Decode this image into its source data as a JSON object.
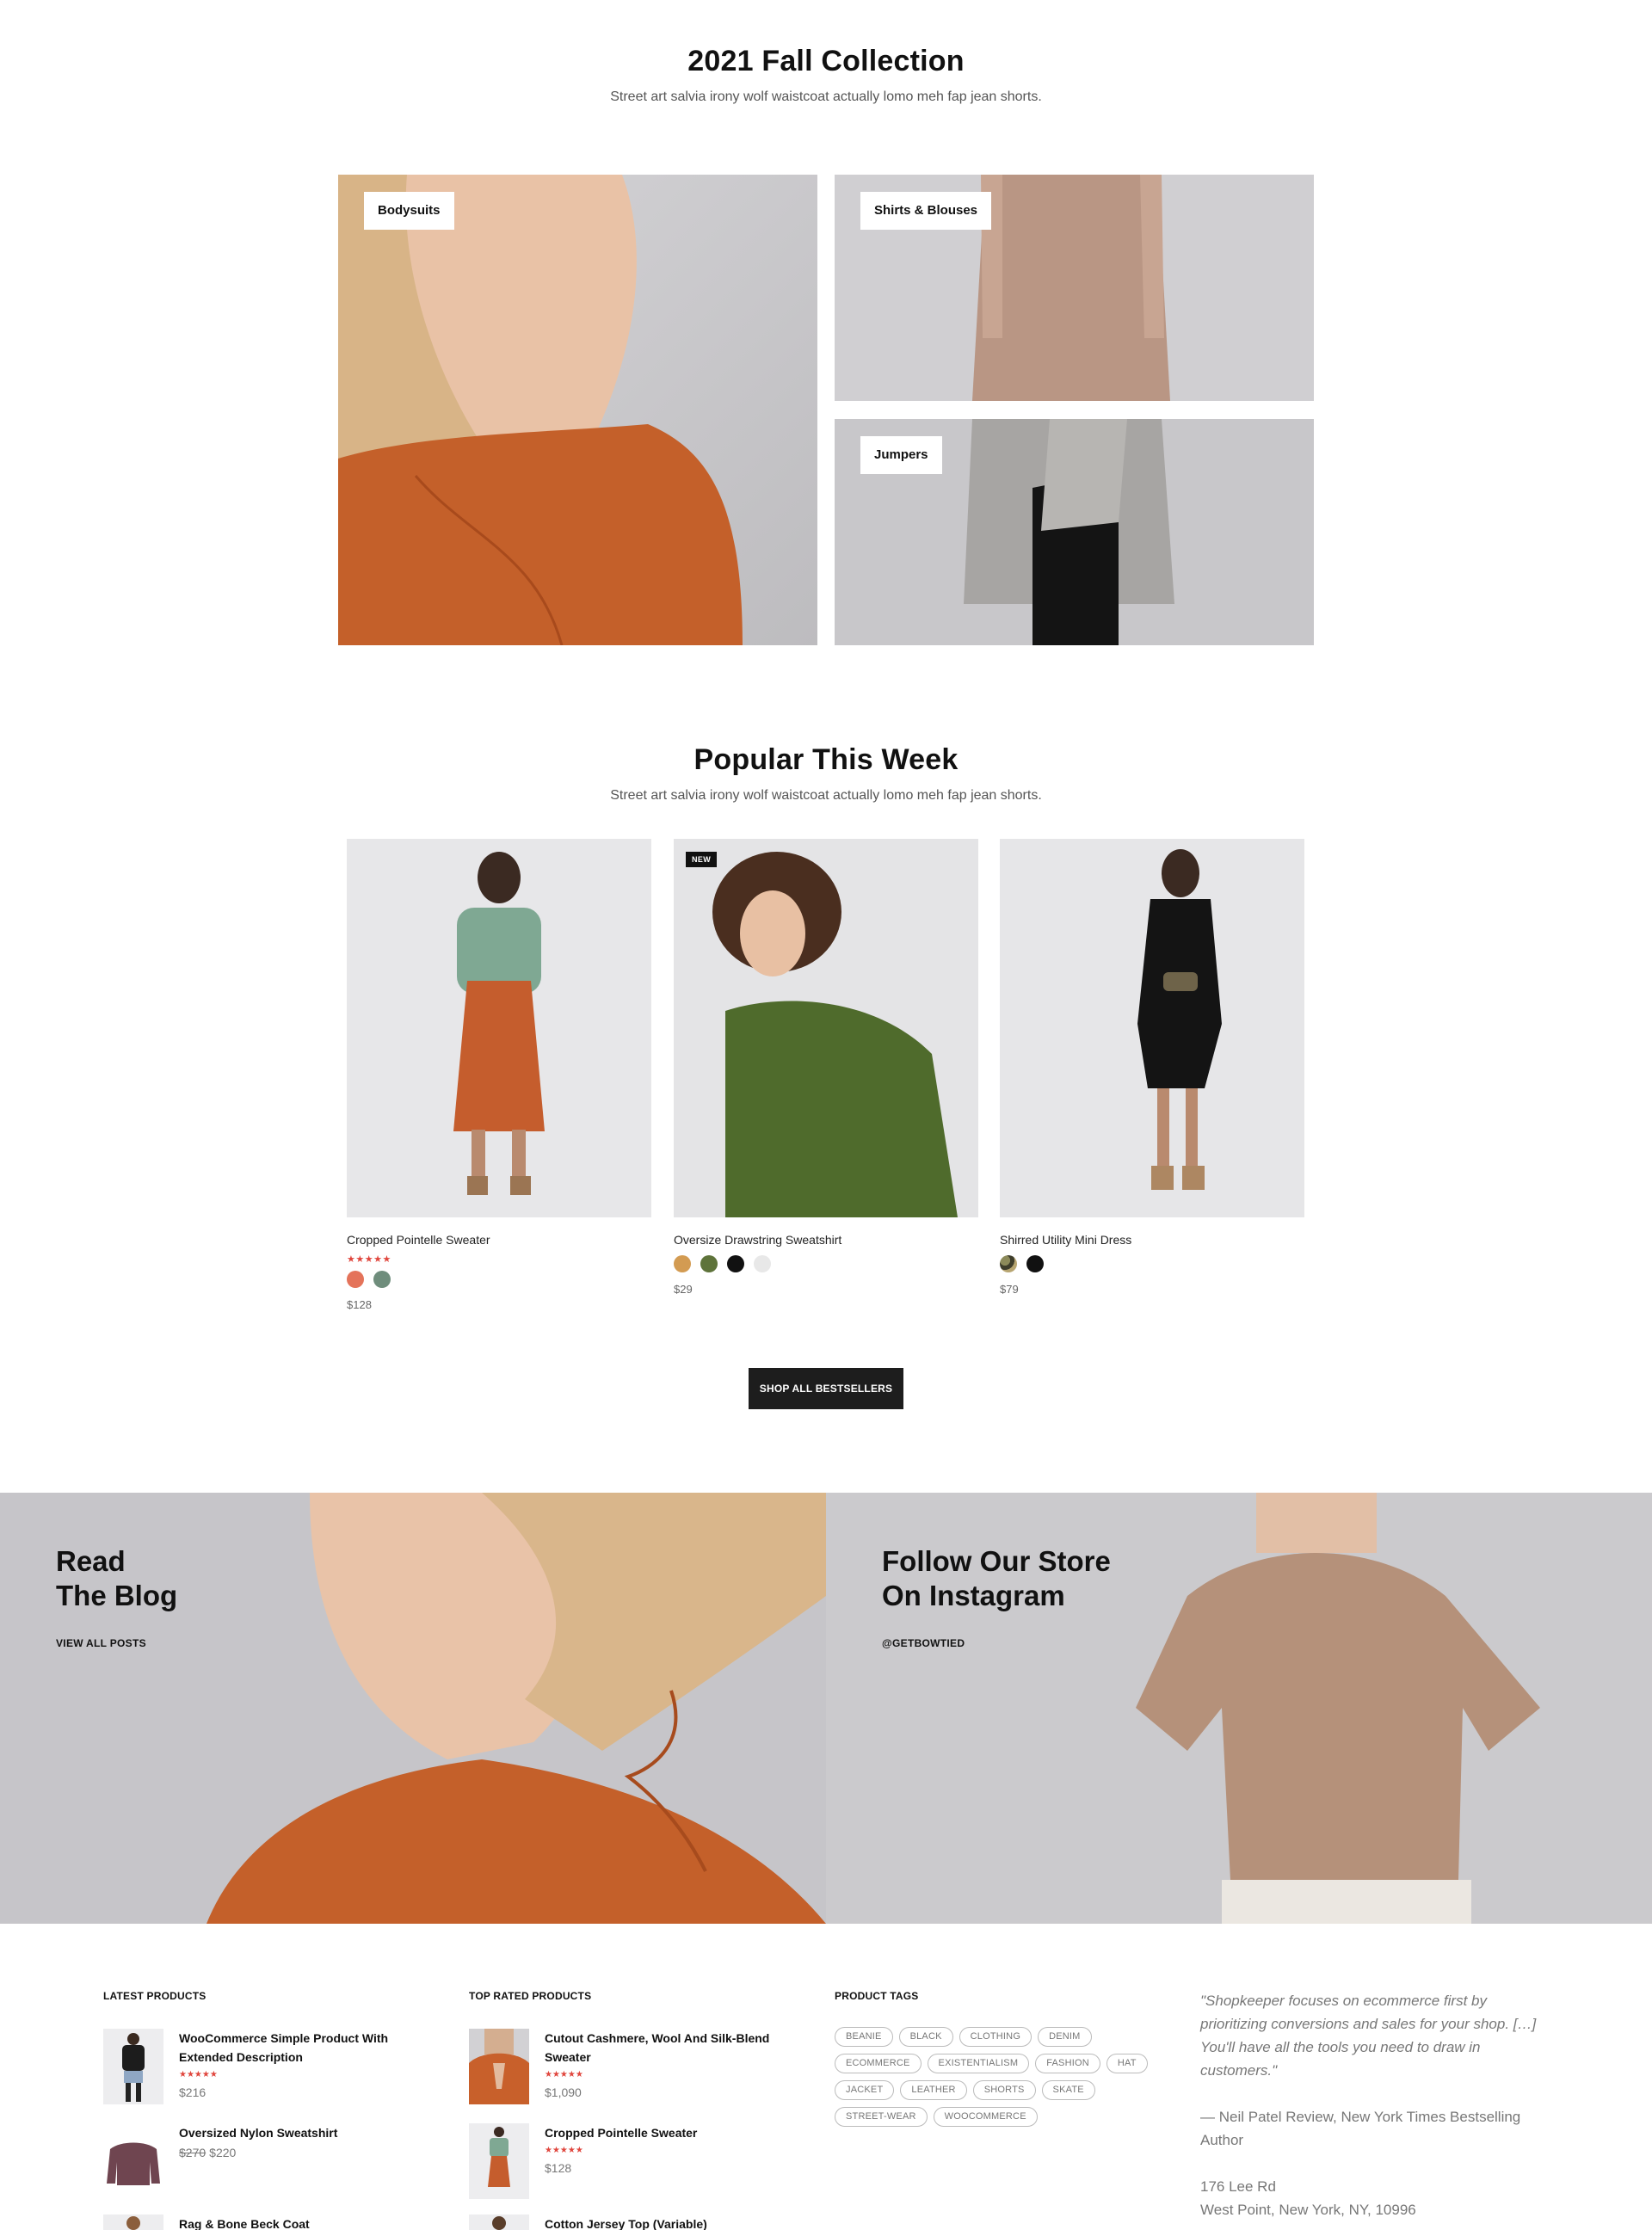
{
  "collection": {
    "title": "2021 Fall Collection",
    "subtitle": "Street art salvia irony wolf waistcoat actually lomo meh fap jean shorts.",
    "tiles": [
      {
        "label": "Bodysuits"
      },
      {
        "label": "Shirts & Blouses"
      },
      {
        "label": "Jumpers"
      }
    ]
  },
  "popular": {
    "title": "Popular This Week",
    "subtitle": "Street art salvia irony wolf waistcoat actually lomo meh fap jean shorts.",
    "products": [
      {
        "name": "Cropped Pointelle Sweater",
        "stars": "★★★★★",
        "price": "$128",
        "swatches": [
          "#e4735a",
          "#6f8d7c"
        ]
      },
      {
        "name": "Oversize Drawstring Sweatshirt",
        "badge": "NEW",
        "price": "$29",
        "swatches": [
          "#d39b52",
          "#5e733a",
          "#111111",
          "#e8e8e8"
        ]
      },
      {
        "name": "Shirred Utility Mini Dress",
        "price": "$79",
        "swatches": [
          "camo",
          "#111111"
        ]
      }
    ],
    "button": "SHOP ALL BESTSELLERS"
  },
  "banners": {
    "blog": {
      "title": "Read\nThe Blog",
      "link": "VIEW ALL POSTS"
    },
    "instagram": {
      "title": "Follow Our Store\nOn Instagram",
      "link": "@GETBOWTIED"
    }
  },
  "footer": {
    "latest": {
      "title": "LATEST PRODUCTS",
      "items": [
        {
          "name": "WooCommerce Simple Product With Extended Description",
          "stars": "★★★★★",
          "price": "$216"
        },
        {
          "name": "Oversized Nylon Sweatshirt",
          "old_price": "$270",
          "price": "$220"
        },
        {
          "name": "Rag & Bone Beck Coat"
        }
      ]
    },
    "top_rated": {
      "title": "TOP RATED PRODUCTS",
      "items": [
        {
          "name": "Cutout Cashmere, Wool And Silk-Blend Sweater",
          "stars": "★★★★★",
          "price": "$1,090"
        },
        {
          "name": "Cropped Pointelle Sweater",
          "stars": "★★★★★",
          "price": "$128"
        },
        {
          "name": "Cotton Jersey Top (Variable)"
        }
      ]
    },
    "tags": {
      "title": "PRODUCT TAGS",
      "items": [
        "BEANIE",
        "BLACK",
        "CLOTHING",
        "DENIM",
        "ECOMMERCE",
        "EXISTENTIALISM",
        "FASHION",
        "HAT",
        "JACKET",
        "LEATHER",
        "SHORTS",
        "SKATE",
        "STREET-WEAR",
        "WOOCOMMERCE"
      ]
    },
    "about": {
      "quote": "\"Shopkeeper focuses on ecommerce first by prioritizing conversions and sales for your shop. […] You'll have all the tools you need to draw in customers.\"",
      "author": "— Neil Patel Review, New York Times Bestselling Author",
      "address1": "176 Lee Rd",
      "address2": "West Point, New York, NY, 10996"
    }
  }
}
